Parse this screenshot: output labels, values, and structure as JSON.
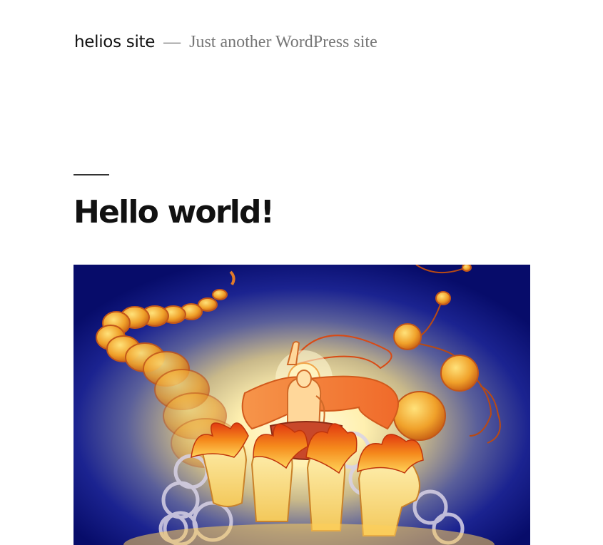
{
  "site": {
    "title": "helios site",
    "separator": "—",
    "description": "Just another WordPress site"
  },
  "post": {
    "title": "Hello world!",
    "featured_image": "helios-chariot-illustration"
  },
  "colors": {
    "text": "#111111",
    "muted": "#767676",
    "image_background": "#0a0f6e",
    "sun_glow": "#fff6c4",
    "fire": "#f07a1a"
  }
}
